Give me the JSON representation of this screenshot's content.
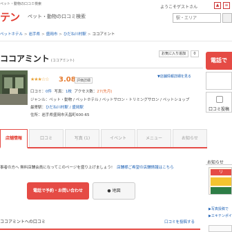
{
  "header": {
    "tagline": "ペット・動物の口コミ検索",
    "logo": "テン",
    "site_sub": "ペット・動物の口コミ検索",
    "welcome": "ようこそゲストさん",
    "search_placeholder": "駅・エリア"
  },
  "breadcrumb": [
    "ペットホテル",
    "岩手県",
    "盛岡市",
    "ひだね川村駅",
    "ココアミント"
  ],
  "shop": {
    "name": "ココアミント",
    "kana": "(ココアミント)",
    "fav_label": "お気に入り追加",
    "fav_count": "0",
    "stars": "★★★☆☆",
    "score": "3.08",
    "rate_tag": "評価詳細",
    "tag_link": "▼店舗情報詳細を見る"
  },
  "info": {
    "reviews_label": "口コミ：",
    "reviews_count": "0件",
    "photos_label": "写真：",
    "photos_count": "1枚",
    "access_label": "アクセス数：",
    "access_count": "27(先月)",
    "genre_label": "ジャンル：",
    "genre_value": "ペット・動物 / ペットホテル / ペットサロン・トリミングサロン / ペットショップ",
    "station_label": "最寄駅：",
    "station_value": "ひだね川村駅 / 盛岡駅",
    "address_label": "住所：",
    "address_value": "岩手県盛岡市天昌町600-65"
  },
  "cta": {
    "call_short": "電話で",
    "post_label": "口コミ投稿"
  },
  "tabs": [
    "店舗情報",
    "口コミ",
    "写真 (1)",
    "イベント",
    "メニュー",
    "お知らせ"
  ],
  "notice": {
    "text": "事者の方へ 無料店舗会員になってこのページを盛り上げましょう!",
    "link": "店舗様ご希望の店舗情報はこちら"
  },
  "buttons": {
    "call": "電話で予約・お問い合わせ",
    "map": "地図"
  },
  "reviews": {
    "heading": "ココアミントへの口コミ",
    "post_link": "口コミを投稿する"
  },
  "sidebar": {
    "caption": "お知らせ",
    "banner_label": "リ",
    "links": [
      "▶写真投稿で",
      "▶エキテンポイ"
    ]
  }
}
